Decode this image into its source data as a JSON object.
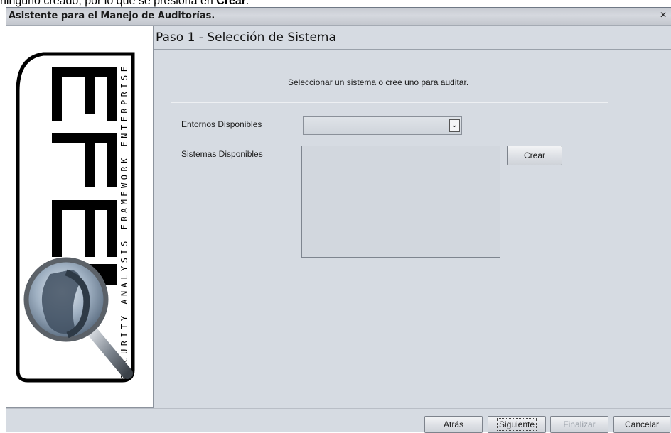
{
  "document": {
    "caption_before": "ninguno creado, por lo que se presiona en ",
    "caption_bold": "Crear",
    "caption_after": "."
  },
  "window": {
    "title": "Asistente para el Manejo de Auditorías.",
    "close_glyph": "×"
  },
  "logo": {
    "letters": "SAFE",
    "tagline": "SECURITY ANALYSIS FRAMEWORK ENTERPRISE",
    "icon": "magnifying-glass-icon"
  },
  "step": {
    "title": "Paso 1 - Selección de Sistema",
    "instruction": "Seleccionar un sistema o cree uno para auditar."
  },
  "form": {
    "environments_label": "Entornos Disponibles",
    "environments_selected": "",
    "systems_label": "Sistemas Disponibles",
    "systems_items": [],
    "create_button": "Crear",
    "dropdown_glyph": "⌄"
  },
  "footer": {
    "back": "Atrás",
    "next": "Siguiente",
    "finish": "Finalizar",
    "cancel": "Cancelar"
  }
}
